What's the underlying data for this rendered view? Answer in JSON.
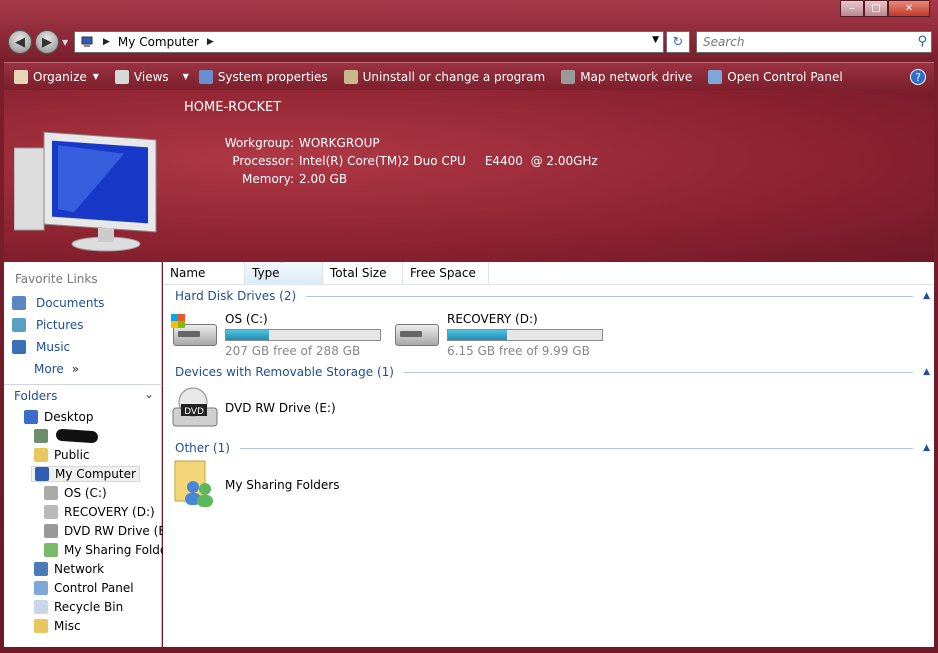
{
  "window": {
    "minimize": "‒",
    "maximize": "□",
    "close": "✕"
  },
  "address": {
    "location": "My Computer",
    "search_placeholder": "Search"
  },
  "toolbar": {
    "organize": "Organize",
    "views": "Views",
    "system_properties": "System properties",
    "uninstall": "Uninstall or change a program",
    "map_drive": "Map network drive",
    "control_panel": "Open Control Panel",
    "help": "?"
  },
  "banner": {
    "pc_name": "HOME-ROCKET",
    "workgroup_label": "Workgroup:",
    "workgroup": "WORKGROUP",
    "processor_label": "Processor:",
    "processor": "Intel(R) Core(TM)2 Duo CPU     E4400  @ 2.00GHz",
    "memory_label": "Memory:",
    "memory": "2.00 GB"
  },
  "favorites": {
    "header": "Favorite Links",
    "items": [
      "Documents",
      "Pictures",
      "Music",
      "More"
    ],
    "more_arrow": "»"
  },
  "folders": {
    "header": "Folders",
    "tree": [
      "Desktop",
      "",
      "Public",
      "My Computer",
      "OS (C:)",
      "RECOVERY (D:)",
      "DVD RW Drive (E:)",
      "My Sharing Folders",
      "Network",
      "Control Panel",
      "Recycle Bin",
      "Misc"
    ]
  },
  "columns": [
    "Name",
    "Type",
    "Total Size",
    "Free Space"
  ],
  "groups": {
    "hdd": "Hard Disk Drives (2)",
    "removable": "Devices with Removable Storage (1)",
    "other": "Other (1)"
  },
  "drives": [
    {
      "name": "OS (C:)",
      "free_text": "207 GB free of 288 GB",
      "used_fraction": 0.28
    },
    {
      "name": "RECOVERY (D:)",
      "free_text": "6.15 GB free of 9.99 GB",
      "used_fraction": 0.38
    }
  ],
  "dvd": {
    "name": "DVD RW Drive (E:)",
    "label": "DVD"
  },
  "other_item": "My Sharing Folders",
  "colors": {
    "accent": "#1e4e94",
    "frame": "#8c2230",
    "bar": "#1f8cb4"
  }
}
